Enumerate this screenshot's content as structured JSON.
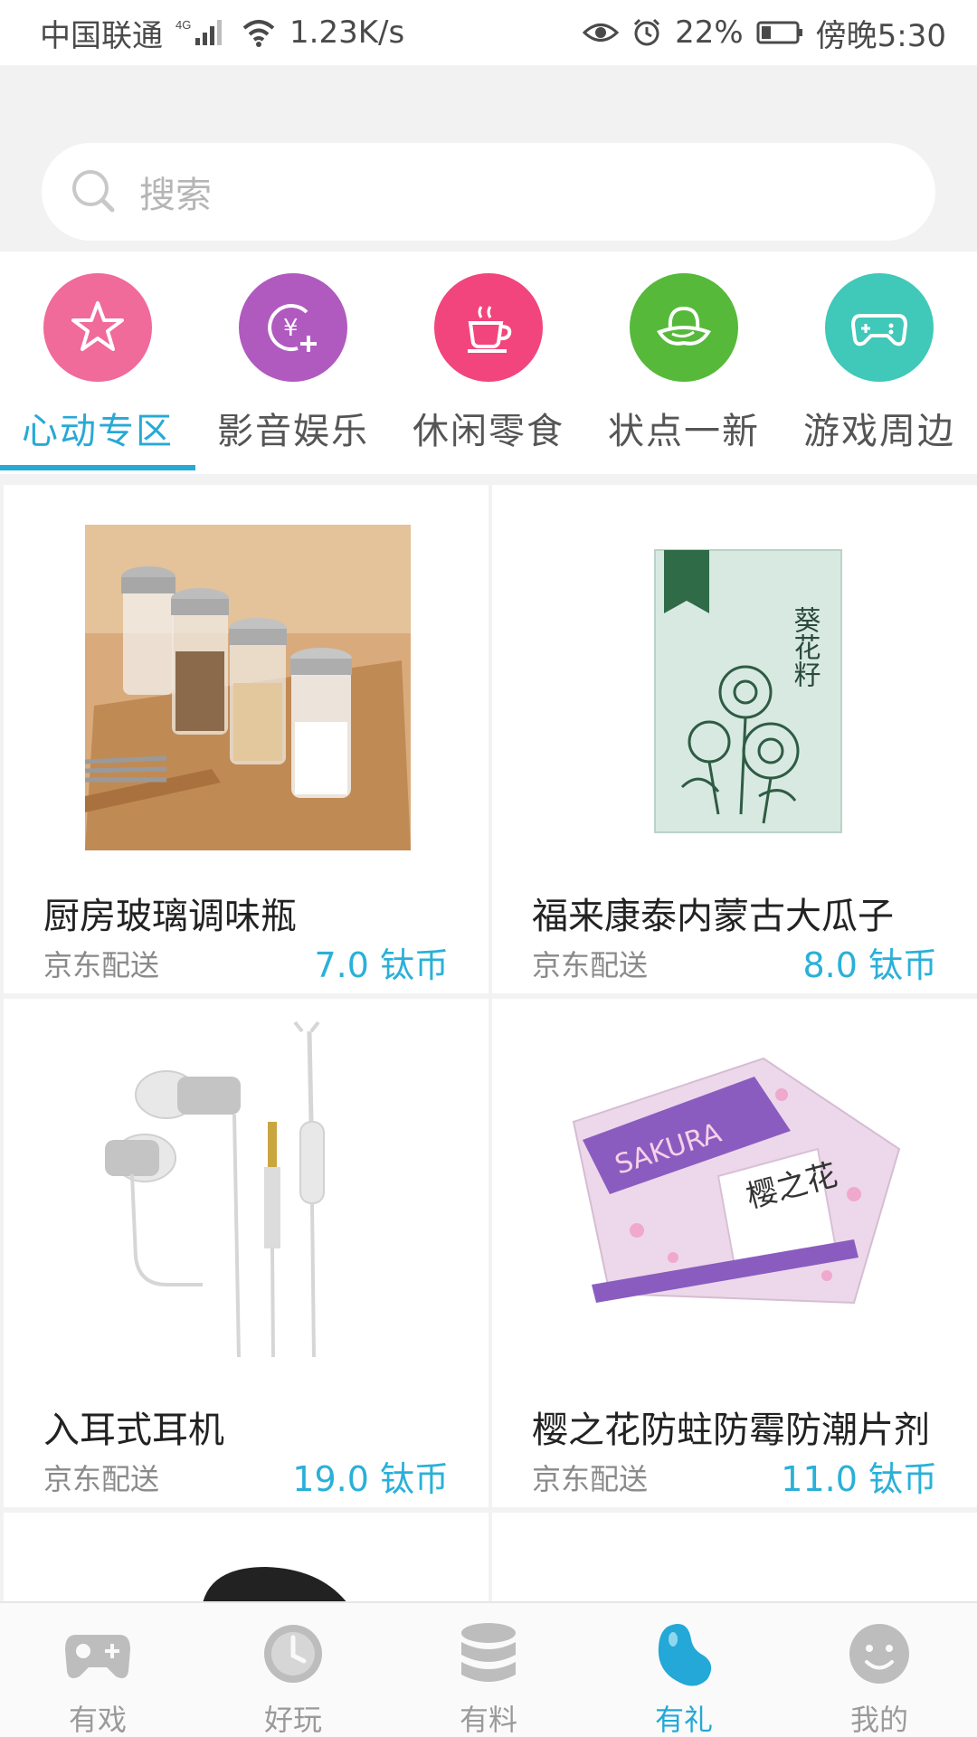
{
  "status_bar": {
    "carrier": "中国联通",
    "network": "4G",
    "speed": "1.23K/s",
    "battery": "22%",
    "time": "傍晚5:30"
  },
  "search": {
    "placeholder": "搜索"
  },
  "categories": [
    {
      "label": "心动专区",
      "icon": "star-icon",
      "color": "#f06a9a",
      "active": true
    },
    {
      "label": "影音娱乐",
      "icon": "coin-plus-icon",
      "color": "#b05ac0"
    },
    {
      "label": "休闲零食",
      "icon": "coffee-cup-icon",
      "color": "#f2457d"
    },
    {
      "label": "状点一新",
      "icon": "hat-icon",
      "color": "#56b93a"
    },
    {
      "label": "游戏周边",
      "icon": "gamepad-icon",
      "color": "#40c8b8"
    }
  ],
  "products": [
    {
      "title": "厨房玻璃调味瓶",
      "shop": "京东配送",
      "price": "7.0 钛币"
    },
    {
      "title": "福来康泰内蒙古大瓜子",
      "shop": "京东配送",
      "price": "8.0 钛币"
    },
    {
      "title": "入耳式耳机",
      "shop": "京东配送",
      "price": "19.0 钛币"
    },
    {
      "title": "樱之花防蛀防霉防潮片剂",
      "shop": "京东配送",
      "price": "11.0 钛币"
    }
  ],
  "product_image_text": {
    "sunflower_pack": "葵花籽",
    "sakura_pack": "SAKURA",
    "sakura_name": "樱之花"
  },
  "bottom_nav": [
    {
      "label": "有戏",
      "icon": "gamepad-icon"
    },
    {
      "label": "好玩",
      "icon": "clock-icon"
    },
    {
      "label": "有料",
      "icon": "database-icon"
    },
    {
      "label": "有礼",
      "icon": "bean-icon",
      "active": true
    },
    {
      "label": "我的",
      "icon": "smiley-icon"
    }
  ],
  "colors": {
    "accent": "#27a9d6",
    "price": "#2ab0d8",
    "background": "#f2f2f2"
  }
}
